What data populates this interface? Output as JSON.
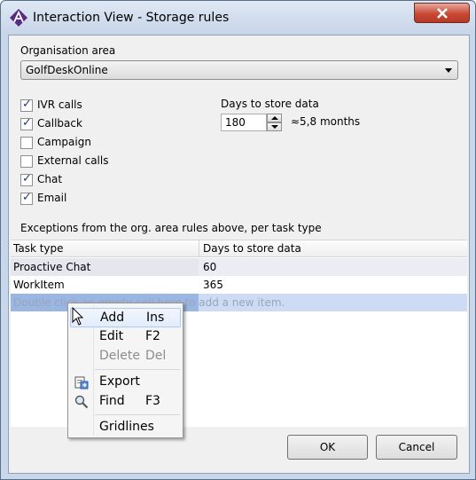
{
  "window": {
    "title": "Interaction View - Storage rules"
  },
  "org_area": {
    "label": "Organisation area",
    "value": "GolfDeskOnline"
  },
  "checkboxes": [
    {
      "label": "IVR calls",
      "checked": true
    },
    {
      "label": "Callback",
      "checked": true
    },
    {
      "label": "Campaign",
      "checked": false
    },
    {
      "label": "External calls",
      "checked": false
    },
    {
      "label": "Chat",
      "checked": true
    },
    {
      "label": "Email",
      "checked": true
    }
  ],
  "days": {
    "label": "Days to store data",
    "value": "180",
    "months_text": "≈5,8 months"
  },
  "exceptions": {
    "label": "Exceptions from the org. area rules above, per task type",
    "columns": [
      "Task type",
      "Days to store data"
    ],
    "rows": [
      {
        "task_type": "Proactive Chat",
        "days": "60"
      },
      {
        "task_type": "WorkItem",
        "days": "365"
      }
    ],
    "new_row_hint": "Double click an empty cell here to add a new item."
  },
  "context_menu": {
    "items": [
      {
        "label": "Add",
        "shortcut": "Ins",
        "icon": "",
        "disabled": false
      },
      {
        "label": "Edit",
        "shortcut": "F2",
        "icon": "",
        "disabled": false
      },
      {
        "label": "Delete",
        "shortcut": "Del",
        "icon": "",
        "disabled": true
      },
      {
        "label": "Export",
        "shortcut": "",
        "icon": "export-icon",
        "disabled": false
      },
      {
        "label": "Find",
        "shortcut": "F3",
        "icon": "magnifier-icon",
        "disabled": false
      },
      {
        "label": "Gridlines",
        "shortcut": "",
        "icon": "",
        "disabled": false
      }
    ]
  },
  "buttons": {
    "ok": "OK",
    "cancel": "Cancel"
  },
  "colors": {
    "selection": "#cddcf4",
    "close_button": "#c74a36",
    "title_bar": "#c7d5e8"
  }
}
